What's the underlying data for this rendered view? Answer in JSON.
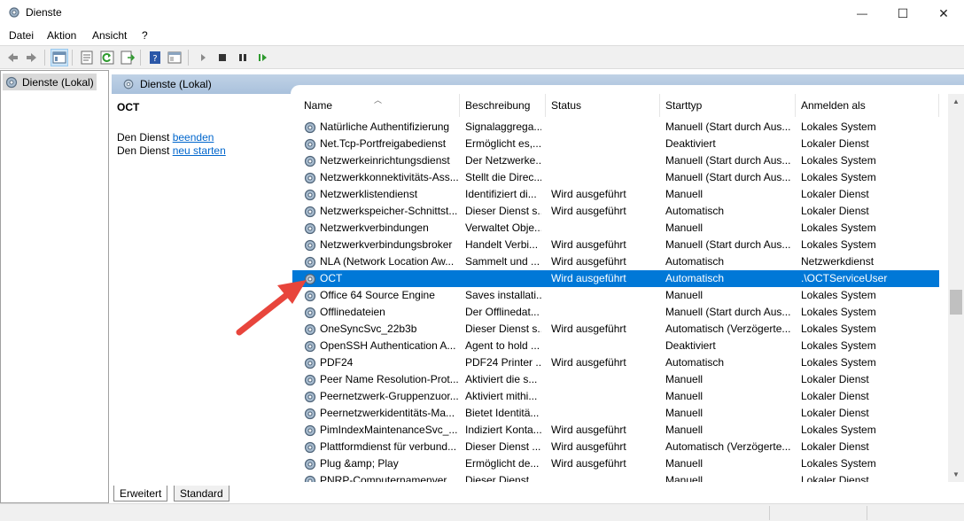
{
  "window": {
    "title": "Dienste",
    "minimize_glyph": "—",
    "maximize_glyph": "☐",
    "close_glyph": "✕"
  },
  "menu": [
    "Datei",
    "Aktion",
    "Ansicht",
    "?"
  ],
  "toolbar": {
    "icons": [
      "back-icon",
      "forward-icon",
      "console-tree-icon",
      "properties-icon",
      "refresh-icon",
      "export-list-icon",
      "help-icon",
      "view-icon",
      "start-service-icon",
      "stop-service-icon",
      "pause-service-icon",
      "resume-service-icon"
    ]
  },
  "tree": {
    "item": "Dienste (Lokal)"
  },
  "pane": {
    "header": "Dienste (Lokal)",
    "selected_service": "OCT",
    "action1_prefix": "Den Dienst ",
    "action1_link": "beenden",
    "action2_prefix": "Den Dienst ",
    "action2_link": "neu starten"
  },
  "columns": [
    "Name",
    "Beschreibung",
    "Status",
    "Starttyp",
    "Anmelden als"
  ],
  "services": [
    {
      "name": "Natürliche Authentifizierung",
      "desc": "Signalaggrega...",
      "status": "",
      "start": "Manuell (Start durch Aus...",
      "logon": "Lokales System"
    },
    {
      "name": "Net.Tcp-Portfreigabedienst",
      "desc": "Ermöglicht es,...",
      "status": "",
      "start": "Deaktiviert",
      "logon": "Lokaler Dienst"
    },
    {
      "name": "Netzwerkeinrichtungsdienst",
      "desc": "Der Netzwerke...",
      "status": "",
      "start": "Manuell (Start durch Aus...",
      "logon": "Lokales System"
    },
    {
      "name": "Netzwerkkonnektivitäts-Ass...",
      "desc": "Stellt die Direc...",
      "status": "",
      "start": "Manuell (Start durch Aus...",
      "logon": "Lokales System"
    },
    {
      "name": "Netzwerklistendienst",
      "desc": "Identifiziert di...",
      "status": "Wird ausgeführt",
      "start": "Manuell",
      "logon": "Lokaler Dienst"
    },
    {
      "name": "Netzwerkspeicher-Schnittst...",
      "desc": "Dieser Dienst s...",
      "status": "Wird ausgeführt",
      "start": "Automatisch",
      "logon": "Lokaler Dienst"
    },
    {
      "name": "Netzwerkverbindungen",
      "desc": "Verwaltet Obje...",
      "status": "",
      "start": "Manuell",
      "logon": "Lokales System"
    },
    {
      "name": "Netzwerkverbindungsbroker",
      "desc": "Handelt Verbi...",
      "status": "Wird ausgeführt",
      "start": "Manuell (Start durch Aus...",
      "logon": "Lokales System"
    },
    {
      "name": "NLA (Network Location Aw...",
      "desc": "Sammelt und ...",
      "status": "Wird ausgeführt",
      "start": "Automatisch",
      "logon": "Netzwerkdienst"
    },
    {
      "name": "OCT",
      "desc": "",
      "status": "Wird ausgeführt",
      "start": "Automatisch",
      "logon": ".\\OCTServiceUser",
      "selected": true
    },
    {
      "name": "Office 64 Source Engine",
      "desc": "Saves installati...",
      "status": "",
      "start": "Manuell",
      "logon": "Lokales System"
    },
    {
      "name": "Offlinedateien",
      "desc": "Der Offlinedat...",
      "status": "",
      "start": "Manuell (Start durch Aus...",
      "logon": "Lokales System"
    },
    {
      "name": "OneSyncSvc_22b3b",
      "desc": "Dieser Dienst s...",
      "status": "Wird ausgeführt",
      "start": "Automatisch (Verzögerte...",
      "logon": "Lokales System"
    },
    {
      "name": "OpenSSH Authentication A...",
      "desc": "Agent to hold ...",
      "status": "",
      "start": "Deaktiviert",
      "logon": "Lokales System"
    },
    {
      "name": "PDF24",
      "desc": "PDF24 Printer ...",
      "status": "Wird ausgeführt",
      "start": "Automatisch",
      "logon": "Lokales System"
    },
    {
      "name": "Peer Name Resolution-Prot...",
      "desc": "Aktiviert die s...",
      "status": "",
      "start": "Manuell",
      "logon": "Lokaler Dienst"
    },
    {
      "name": "Peernetzwerk-Gruppenzuor...",
      "desc": "Aktiviert mithi...",
      "status": "",
      "start": "Manuell",
      "logon": "Lokaler Dienst"
    },
    {
      "name": "Peernetzwerkidentitäts-Ma...",
      "desc": "Bietet Identitä...",
      "status": "",
      "start": "Manuell",
      "logon": "Lokaler Dienst"
    },
    {
      "name": "PimIndexMaintenanceSvc_...",
      "desc": "Indiziert Konta...",
      "status": "Wird ausgeführt",
      "start": "Manuell",
      "logon": "Lokales System"
    },
    {
      "name": "Plattformdienst für verbund...",
      "desc": "Dieser Dienst ...",
      "status": "Wird ausgeführt",
      "start": "Automatisch (Verzögerte...",
      "logon": "Lokaler Dienst"
    },
    {
      "name": "Plug &amp; Play",
      "desc": "Ermöglicht de...",
      "status": "Wird ausgeführt",
      "start": "Manuell",
      "logon": "Lokales System"
    },
    {
      "name": "PNRP-Computernamenver...",
      "desc": "Dieser Dienst ...",
      "status": "",
      "start": "Manuell",
      "logon": "Lokaler Dienst"
    }
  ],
  "tabs": [
    "Erweitert",
    "Standard"
  ],
  "colors": {
    "selection": "#0078d7",
    "header_band": "#b4c8e0",
    "link": "#0066cc",
    "arrow": "#e8453c"
  }
}
